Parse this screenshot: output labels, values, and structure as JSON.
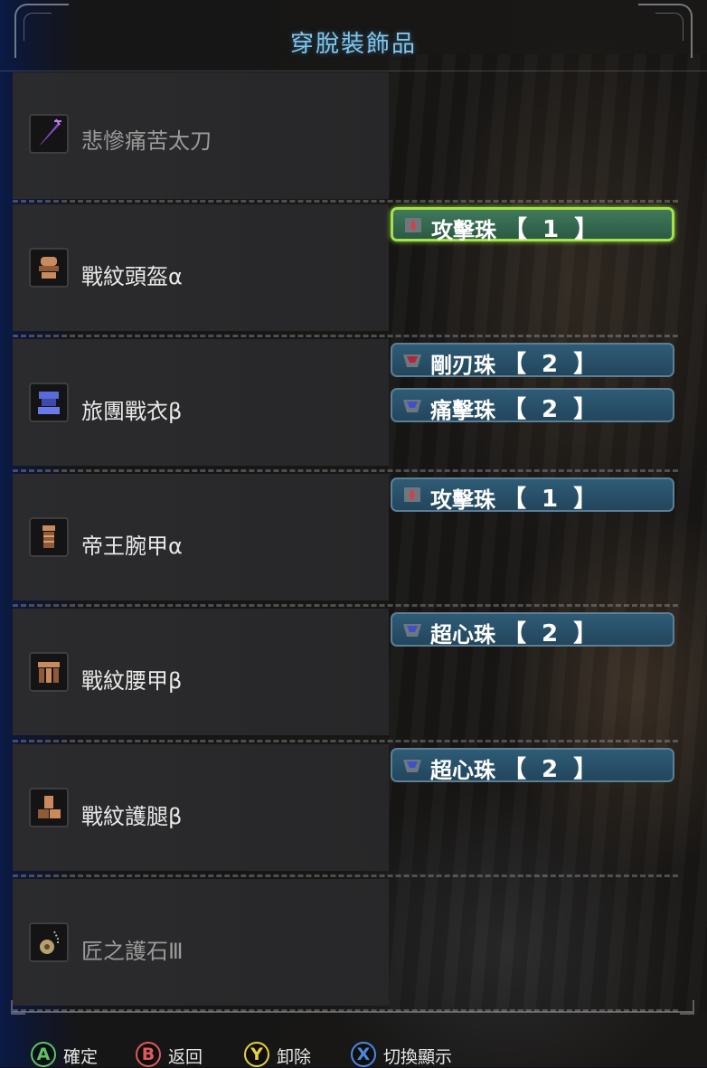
{
  "title": "穿脫裝飾品",
  "equipment": [
    {
      "name": "悲慘痛苦太刀",
      "icon": "weapon-long-sword-icon",
      "dim": true,
      "decorations": []
    },
    {
      "name": "戰紋頭盔α",
      "icon": "helm-icon",
      "dim": false,
      "decorations": [
        {
          "name": "攻擊珠",
          "level": "【 1 】",
          "jewel": "level-1-jewel-icon",
          "selected": true
        }
      ]
    },
    {
      "name": "旅團戰衣β",
      "icon": "chest-armor-icon",
      "dim": false,
      "decorations": [
        {
          "name": "剛刃珠",
          "level": "【 2 】",
          "jewel": "level-2-jewel-red-icon",
          "selected": false
        },
        {
          "name": "痛擊珠",
          "level": "【 2 】",
          "jewel": "level-2-jewel-blue-icon",
          "selected": false
        }
      ]
    },
    {
      "name": "帝王腕甲α",
      "icon": "arm-armor-icon",
      "dim": false,
      "decorations": [
        {
          "name": "攻擊珠",
          "level": "【 1 】",
          "jewel": "level-1-jewel-icon",
          "selected": false
        }
      ]
    },
    {
      "name": "戰紋腰甲β",
      "icon": "waist-armor-icon",
      "dim": false,
      "decorations": [
        {
          "name": "超心珠",
          "level": "【 2 】",
          "jewel": "level-2-jewel-blue-icon",
          "selected": false
        }
      ]
    },
    {
      "name": "戰紋護腿β",
      "icon": "leg-armor-icon",
      "dim": false,
      "decorations": [
        {
          "name": "超心珠",
          "level": "【 2 】",
          "jewel": "level-2-jewel-blue-icon",
          "selected": false
        }
      ]
    },
    {
      "name": "匠之護石Ⅲ",
      "icon": "charm-icon",
      "dim": true,
      "decorations": []
    }
  ],
  "footer": [
    {
      "key": "A",
      "label": "確定",
      "color": "#5fc35f"
    },
    {
      "key": "B",
      "label": "返回",
      "color": "#e05a5a"
    },
    {
      "key": "Y",
      "label": "卸除",
      "color": "#e8d040"
    },
    {
      "key": "X",
      "label": "切換顯示",
      "color": "#4a8ae0"
    }
  ],
  "colors": {
    "title": "#7fc6ea",
    "selected_border": "#a8e04a",
    "decoration_slot": "#2f5b76"
  }
}
